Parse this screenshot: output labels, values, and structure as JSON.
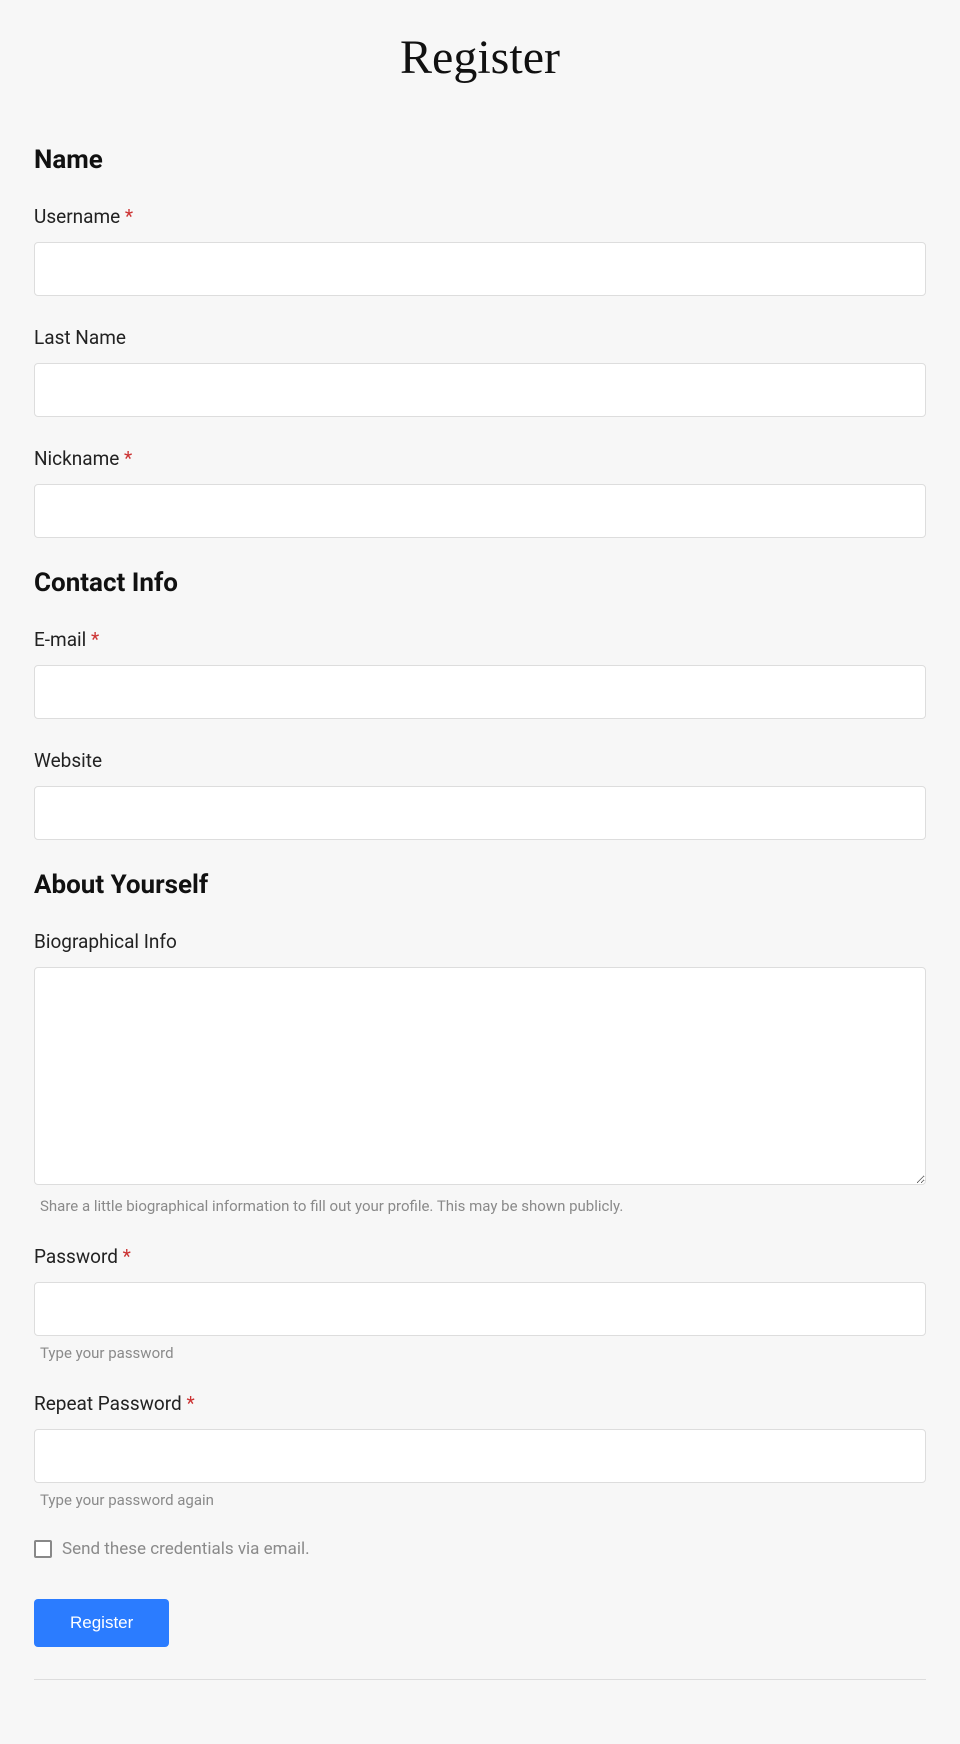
{
  "title": "Register",
  "sections": {
    "name": {
      "heading": "Name",
      "username": {
        "label": "Username ",
        "required": true,
        "value": ""
      },
      "lastname": {
        "label": "Last Name",
        "required": false,
        "value": ""
      },
      "nickname": {
        "label": "Nickname ",
        "required": true,
        "value": ""
      }
    },
    "contact": {
      "heading": "Contact Info",
      "email": {
        "label": "E-mail ",
        "required": true,
        "value": ""
      },
      "website": {
        "label": "Website",
        "required": false,
        "value": ""
      }
    },
    "about": {
      "heading": "About Yourself",
      "bio": {
        "label": "Biographical Info",
        "value": "",
        "help": "Share a little biographical information to fill out your profile. This may be shown publicly."
      },
      "password": {
        "label": "Password ",
        "required": true,
        "value": "",
        "help": "Type your password"
      },
      "repeat_password": {
        "label": "Repeat Password ",
        "required": true,
        "value": "",
        "help": "Type your password again"
      }
    }
  },
  "required_marker": "*",
  "send_credentials": {
    "checked": false,
    "label": "Send these credentials via email."
  },
  "submit_label": "Register"
}
